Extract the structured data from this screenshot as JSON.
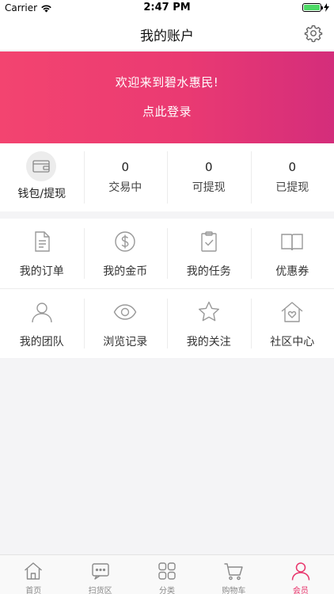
{
  "status_bar": {
    "carrier": "Carrier",
    "time": "2:47 PM"
  },
  "nav": {
    "title": "我的账户",
    "settings_icon": "gear-icon"
  },
  "banner": {
    "welcome": "欢迎来到碧水惠民!",
    "login": "点此登录",
    "gradient_start": "#f34470",
    "gradient_end": "#d42d7b"
  },
  "wallet": {
    "label": "钱包/提现",
    "icon": "wallet-icon",
    "stats": [
      {
        "value": "0",
        "label": "交易中"
      },
      {
        "value": "0",
        "label": "可提现"
      },
      {
        "value": "0",
        "label": "已提现"
      }
    ]
  },
  "grid": {
    "items": [
      {
        "label": "我的订单",
        "icon": "document-icon"
      },
      {
        "label": "我的金币",
        "icon": "coin-icon"
      },
      {
        "label": "我的任务",
        "icon": "clipboard-check-icon"
      },
      {
        "label": "优惠券",
        "icon": "book-icon"
      },
      {
        "label": "我的团队",
        "icon": "person-icon"
      },
      {
        "label": "浏览记录",
        "icon": "eye-icon"
      },
      {
        "label": "我的关注",
        "icon": "star-icon"
      },
      {
        "label": "社区中心",
        "icon": "house-heart-icon"
      }
    ]
  },
  "tab_bar": {
    "active_color": "#e8336a",
    "tabs": [
      {
        "label": "首页",
        "icon": "home-icon"
      },
      {
        "label": "扫货区",
        "icon": "chat-icon"
      },
      {
        "label": "分类",
        "icon": "grid-icon"
      },
      {
        "label": "购物车",
        "icon": "cart-icon"
      },
      {
        "label": "会员",
        "icon": "member-icon",
        "active": true
      }
    ]
  }
}
